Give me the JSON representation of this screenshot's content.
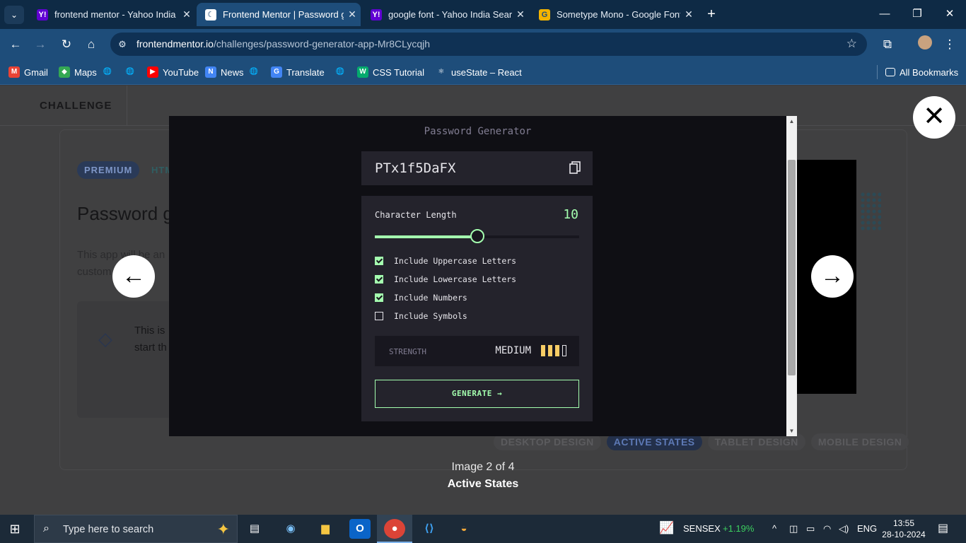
{
  "browser": {
    "tabs": [
      {
        "title": "frontend mentor - Yahoo India S",
        "favicon": "Y!",
        "favicon_color": "#6001d2",
        "active": false
      },
      {
        "title": "Frontend Mentor | Password ge",
        "favicon": "☾",
        "favicon_color": "#ffffff",
        "active": true
      },
      {
        "title": "google font - Yahoo India Searc",
        "favicon": "Y!",
        "favicon_color": "#6001d2",
        "active": false
      },
      {
        "title": "Sometype Mono - Google Fonts",
        "favicon": "G",
        "favicon_color": "#f4b400",
        "active": false
      }
    ],
    "url_host": "frontendmentor.io",
    "url_path": "/challenges/password-generator-app-Mr8CLycqjh",
    "bookmarks": [
      {
        "label": "Gmail",
        "icon": "M",
        "color": "#ea4335"
      },
      {
        "label": "Maps",
        "icon": "◆",
        "color": "#34a853"
      },
      {
        "label": "",
        "icon": "🌐",
        "color": "#1e4d7a"
      },
      {
        "label": "",
        "icon": "🌐",
        "color": "#1e4d7a"
      },
      {
        "label": "YouTube",
        "icon": "▶",
        "color": "#ff0000"
      },
      {
        "label": "News",
        "icon": "N",
        "color": "#4285f4"
      },
      {
        "label": "",
        "icon": "🌐",
        "color": "#1e4d7a"
      },
      {
        "label": "Translate",
        "icon": "G",
        "color": "#4285f4"
      },
      {
        "label": "",
        "icon": "🌐",
        "color": "#1e4d7a"
      },
      {
        "label": "CSS Tutorial",
        "icon": "W",
        "color": "#04aa6d"
      },
      {
        "label": "useState – React",
        "icon": "⚛",
        "color": "#1e4d7a"
      }
    ],
    "all_bookmarks": "All Bookmarks"
  },
  "page": {
    "header_label": "CHALLENGE",
    "premium_badge": "PREMIUM",
    "tag": "HTM",
    "title": "Password g",
    "description": "This app will be an custom stu",
    "info_text": "This is start th",
    "design_tabs": [
      "DESKTOP DESIGN",
      "ACTIVE STATES",
      "TABLET DESIGN",
      "MOBILE DESIGN"
    ],
    "active_design_tab": "ACTIVE STATES"
  },
  "lightbox": {
    "caption_count": "Image 2 of 4",
    "caption_title": "Active States",
    "app": {
      "title": "Password Generator",
      "password": "PTx1f5DaFX",
      "char_length_label": "Character Length",
      "char_length": "10",
      "slider_fraction": 0.5,
      "options": [
        {
          "label": "Include Uppercase Letters",
          "checked": true
        },
        {
          "label": "Include Lowercase Letters",
          "checked": true
        },
        {
          "label": "Include Numbers",
          "checked": true
        },
        {
          "label": "Include Symbols",
          "checked": false
        }
      ],
      "strength_label": "STRENGTH",
      "strength_value": "MEDIUM",
      "strength_bars_filled": 3,
      "strength_bars_total": 4,
      "generate_label": "GENERATE →"
    }
  },
  "taskbar": {
    "search_placeholder": "Type here to search",
    "sensex_label": "SENSEX",
    "sensex_change": "+1.19%",
    "language": "ENG",
    "time": "13:55",
    "date": "28-10-2024"
  },
  "colors": {
    "accent_green": "#a4ffaf",
    "strength_yellow": "#f8cd65",
    "panel": "#24232c",
    "sensex_green": "#3ccf5f"
  }
}
